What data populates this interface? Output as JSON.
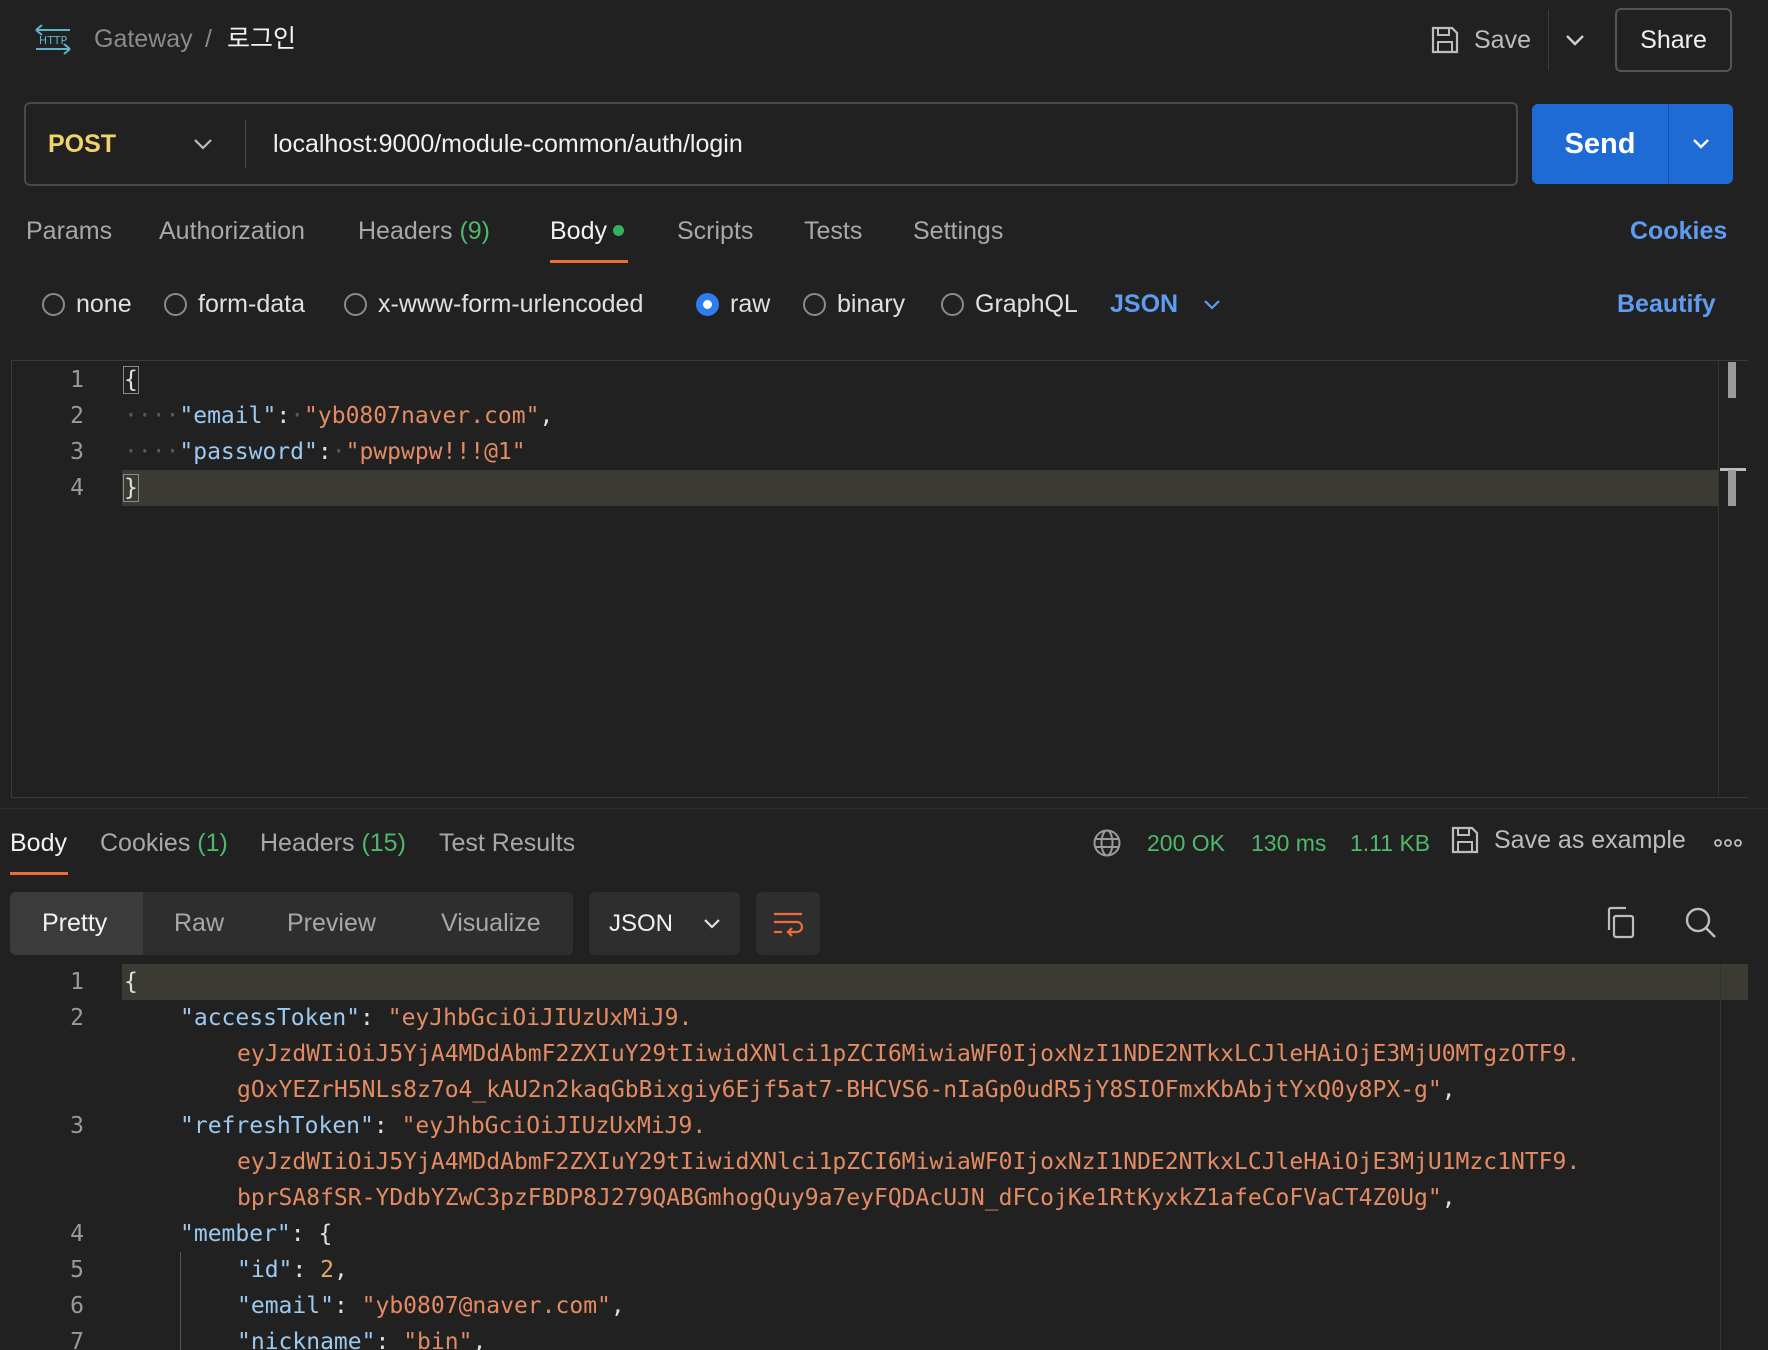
{
  "header": {
    "http_badge": "HTTP",
    "breadcrumb_parent": "Gateway",
    "breadcrumb_sep": "/",
    "breadcrumb_current": "로그인",
    "save_label": "Save",
    "share_label": "Share"
  },
  "request": {
    "method": "POST",
    "url": "localhost:9000/module-common/auth/login",
    "send_label": "Send"
  },
  "request_tabs": {
    "params": "Params",
    "authorization": "Authorization",
    "headers": "Headers",
    "headers_count": "(9)",
    "body": "Body",
    "scripts": "Scripts",
    "tests": "Tests",
    "settings": "Settings",
    "cookies": "Cookies",
    "active": "Body"
  },
  "body_types": {
    "none": "none",
    "form_data": "form-data",
    "urlencoded": "x-www-form-urlencoded",
    "raw": "raw",
    "binary": "binary",
    "graphql": "GraphQL",
    "selected": "raw",
    "language": "JSON",
    "beautify": "Beautify"
  },
  "request_body": {
    "line_numbers": [
      "1",
      "2",
      "3",
      "4"
    ],
    "open_brace": "{",
    "close_brace": "}",
    "email_key": "\"email\"",
    "email_value": "\"yb0807naver.com\"",
    "password_key": "\"password\"",
    "password_value": "\"pwpwpw!!!@1\""
  },
  "response_tabs": {
    "body": "Body",
    "cookies": "Cookies",
    "cookies_count": "(1)",
    "headers": "Headers",
    "headers_count": "(15)",
    "test_results": "Test Results",
    "active": "Body"
  },
  "response_status": {
    "status": "200 OK",
    "time": "130 ms",
    "size": "1.11 KB",
    "save_example": "Save as example"
  },
  "response_view": {
    "pretty": "Pretty",
    "raw": "Raw",
    "preview": "Preview",
    "visualize": "Visualize",
    "active": "Pretty",
    "format": "JSON"
  },
  "response_body": {
    "line_numbers": [
      "1",
      "2",
      "3",
      "4",
      "5",
      "6",
      "7"
    ],
    "open_brace": "{",
    "access_key": "\"accessToken\"",
    "access_val_1": "\"eyJhbGciOiJIUzUxMiJ9.",
    "access_val_2": "eyJzdWIiOiJ5YjA4MDdAbmF2ZXIuY29tIiwidXNlci1pZCI6MiwiaWF0IjoxNzI1NDE2NTkxLCJleHAiOjE3MjU0MTgzOTF9.",
    "access_val_3": "gOxYEZrH5NLs8z7o4_kAU2n2kaqGbBixgiy6Ejf5at7-BHCVS6-nIaGp0udR5jY8SIOFmxKbAbjtYxQ0y8PX-g\"",
    "refresh_key": "\"refreshToken\"",
    "refresh_val_1": "\"eyJhbGciOiJIUzUxMiJ9.",
    "refresh_val_2": "eyJzdWIiOiJ5YjA4MDdAbmF2ZXIuY29tIiwidXNlci1pZCI6MiwiaWF0IjoxNzI1NDE2NTkxLCJleHAiOjE3MjU1Mzc1NTF9.",
    "refresh_val_3": "bprSA8fSR-YDdbYZwC3pzFBDP8J279QABGmhogQuy9a7eyFQDAcUJN_dFCojKe1RtKyxkZ1afeCoFVaCT4Z0Ug\"",
    "member_key": "\"member\"",
    "id_key": "\"id\"",
    "id_val": "2",
    "email_key": "\"email\"",
    "email_val": "\"yb0807@naver.com\"",
    "nickname_key": "\"nickname\"",
    "nickname_val": "\"bin\""
  },
  "colors": {
    "accent": "#ef6c3a",
    "send": "#1f6bd6",
    "link": "#5e9cf2",
    "success": "#4fb86a",
    "method": "#f2d36b"
  },
  "icons": {
    "http": "http-icon",
    "save": "save-icon",
    "chevron": "chevron-down-icon",
    "globe": "globe-icon",
    "more": "more-icon",
    "wrap": "wrap-lines-icon",
    "copy": "copy-icon",
    "search": "search-icon"
  }
}
